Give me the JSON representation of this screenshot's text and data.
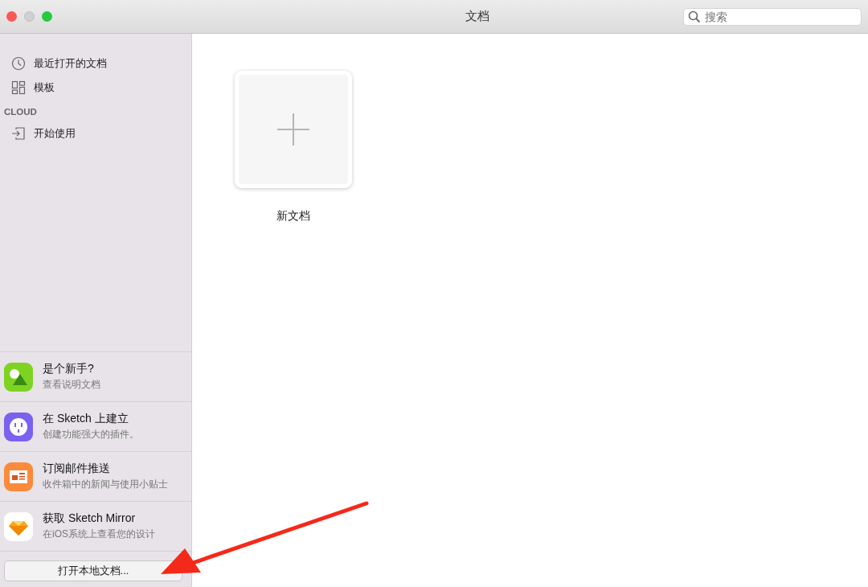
{
  "window": {
    "title": "文档"
  },
  "search": {
    "placeholder": "搜索"
  },
  "sidebar": {
    "items": [
      {
        "label": "最近打开的文档",
        "kind": "clock"
      },
      {
        "label": "模板",
        "kind": "grid"
      }
    ],
    "cloud": {
      "heading": "CLOUD",
      "items": [
        {
          "label": "开始使用",
          "kind": "signin"
        }
      ]
    },
    "promos": [
      {
        "title": "是个新手?",
        "subtitle": "查看说明文档",
        "kind": "shapes",
        "color": "#7ed321"
      },
      {
        "title": "在 Sketch 上建立",
        "subtitle": "创建功能强大的插件。",
        "kind": "plug",
        "color": "#7b61f0"
      },
      {
        "title": "订阅邮件推送",
        "subtitle": "收件箱中的新闻与使用小贴士",
        "kind": "news",
        "color": "#fb8a3c"
      },
      {
        "title": "获取 Sketch Mirror",
        "subtitle": "在iOS系统上查看您的设计",
        "kind": "diamond",
        "color": "#ffffff"
      }
    ],
    "open_button": "打开本地文档..."
  },
  "documents": [
    {
      "label": "新文档",
      "kind": "new"
    }
  ]
}
